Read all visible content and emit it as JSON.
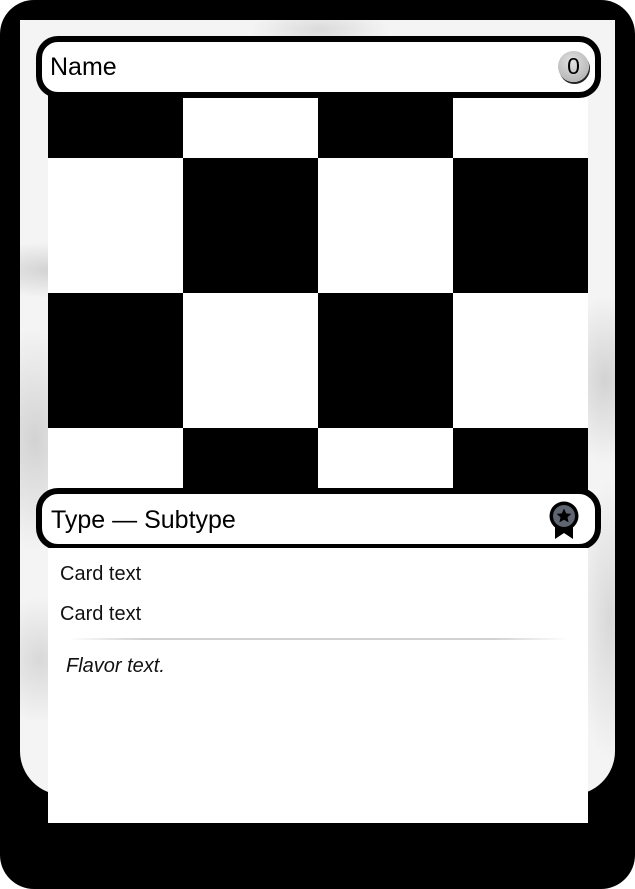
{
  "card": {
    "name": "Name",
    "mana_cost": "0",
    "type_line": "Type — Subtype",
    "rarity_icon": "award-ribbon-icon",
    "rules_text": [
      "Card text",
      "Card text"
    ],
    "flavor_text": "Flavor text.",
    "art": "checkerboard-pattern",
    "colors": {
      "border": "#000000",
      "frame": "#f4f4f4",
      "text_box": "#ffffff",
      "art_dark": "#000000",
      "art_light": "#ffffff"
    }
  }
}
